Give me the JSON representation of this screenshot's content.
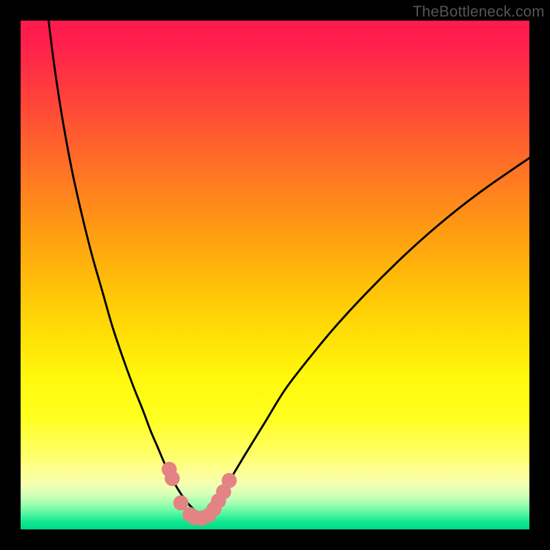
{
  "watermark": "TheBottleneck.com",
  "colors": {
    "black": "#000000",
    "curve": "#000000",
    "marker": "#e38383",
    "gradient_stops": [
      {
        "offset": 0.0,
        "color": "#ff1a4f"
      },
      {
        "offset": 0.04,
        "color": "#ff1e4c"
      },
      {
        "offset": 0.12,
        "color": "#ff3740"
      },
      {
        "offset": 0.22,
        "color": "#ff5a30"
      },
      {
        "offset": 0.32,
        "color": "#ff7c20"
      },
      {
        "offset": 0.42,
        "color": "#ff9e12"
      },
      {
        "offset": 0.52,
        "color": "#ffc008"
      },
      {
        "offset": 0.62,
        "color": "#ffe006"
      },
      {
        "offset": 0.7,
        "color": "#fff80c"
      },
      {
        "offset": 0.78,
        "color": "#ffff20"
      },
      {
        "offset": 0.845,
        "color": "#ffff60"
      },
      {
        "offset": 0.882,
        "color": "#ffff90"
      },
      {
        "offset": 0.91,
        "color": "#f5ffb0"
      },
      {
        "offset": 0.93,
        "color": "#d8ffb8"
      },
      {
        "offset": 0.95,
        "color": "#a0ffb0"
      },
      {
        "offset": 0.97,
        "color": "#50f5a0"
      },
      {
        "offset": 0.985,
        "color": "#10e890"
      },
      {
        "offset": 1.0,
        "color": "#00d884"
      }
    ]
  },
  "chart_data": {
    "type": "line",
    "title": "",
    "xlabel": "",
    "ylabel": "",
    "xlim": [
      0,
      100
    ],
    "ylim": [
      0,
      100
    ],
    "grid": false,
    "series": [
      {
        "name": "left-branch",
        "x": [
          5.5,
          6.5,
          8,
          10,
          12,
          14,
          16,
          18,
          20,
          22,
          24,
          25.5,
          27,
          28.5,
          30,
          31.5,
          33,
          34.5,
          35.5
        ],
        "y": [
          100,
          92,
          82,
          71,
          62,
          54,
          47,
          40,
          34,
          28.5,
          23.5,
          19.5,
          16,
          12.5,
          9.5,
          7,
          5,
          3.5,
          2.5
        ]
      },
      {
        "name": "right-branch",
        "x": [
          35.5,
          37,
          39,
          41,
          44,
          48,
          52,
          57,
          62,
          68,
          74,
          80,
          86,
          92,
          100
        ],
        "y": [
          2.5,
          3.5,
          6,
          9.5,
          14.5,
          21,
          27.5,
          34,
          40,
          46.5,
          52.5,
          58,
          63,
          67.5,
          73
        ]
      }
    ],
    "markers": {
      "name": "markers",
      "x": [
        29.2,
        29.8,
        31.5,
        33.3,
        34.3,
        35.6,
        36.9,
        38.0,
        38.9,
        39.9,
        41.0
      ],
      "y": [
        11.8,
        10.0,
        5.2,
        2.9,
        2.3,
        2.2,
        2.7,
        4.0,
        5.6,
        7.4,
        9.6
      ]
    }
  }
}
